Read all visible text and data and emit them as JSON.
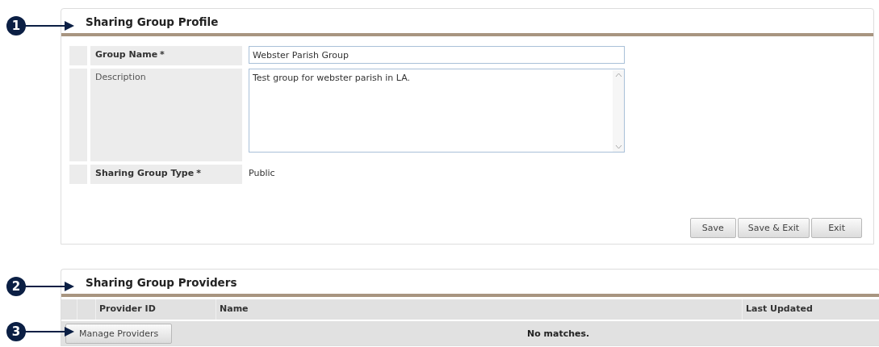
{
  "callouts": [
    "1",
    "2",
    "3"
  ],
  "profile": {
    "title": "Sharing Group Profile",
    "fields": [
      {
        "kind": "input",
        "label": "Group Name",
        "required": true,
        "value": "Webster Parish Group"
      },
      {
        "kind": "textarea",
        "label": "Description",
        "required": false,
        "value": "Test group for webster parish in LA."
      },
      {
        "kind": "text",
        "label": "Sharing Group Type",
        "required": true,
        "value": "Public"
      }
    ],
    "required_mark": "*",
    "buttons": [
      "Save",
      "Save & Exit",
      "Exit"
    ]
  },
  "providers": {
    "title": "Sharing Group Providers",
    "columns": [
      "Provider ID",
      "Name",
      "Last Updated"
    ],
    "manage_button": "Manage Providers",
    "empty_message": "No matches."
  }
}
